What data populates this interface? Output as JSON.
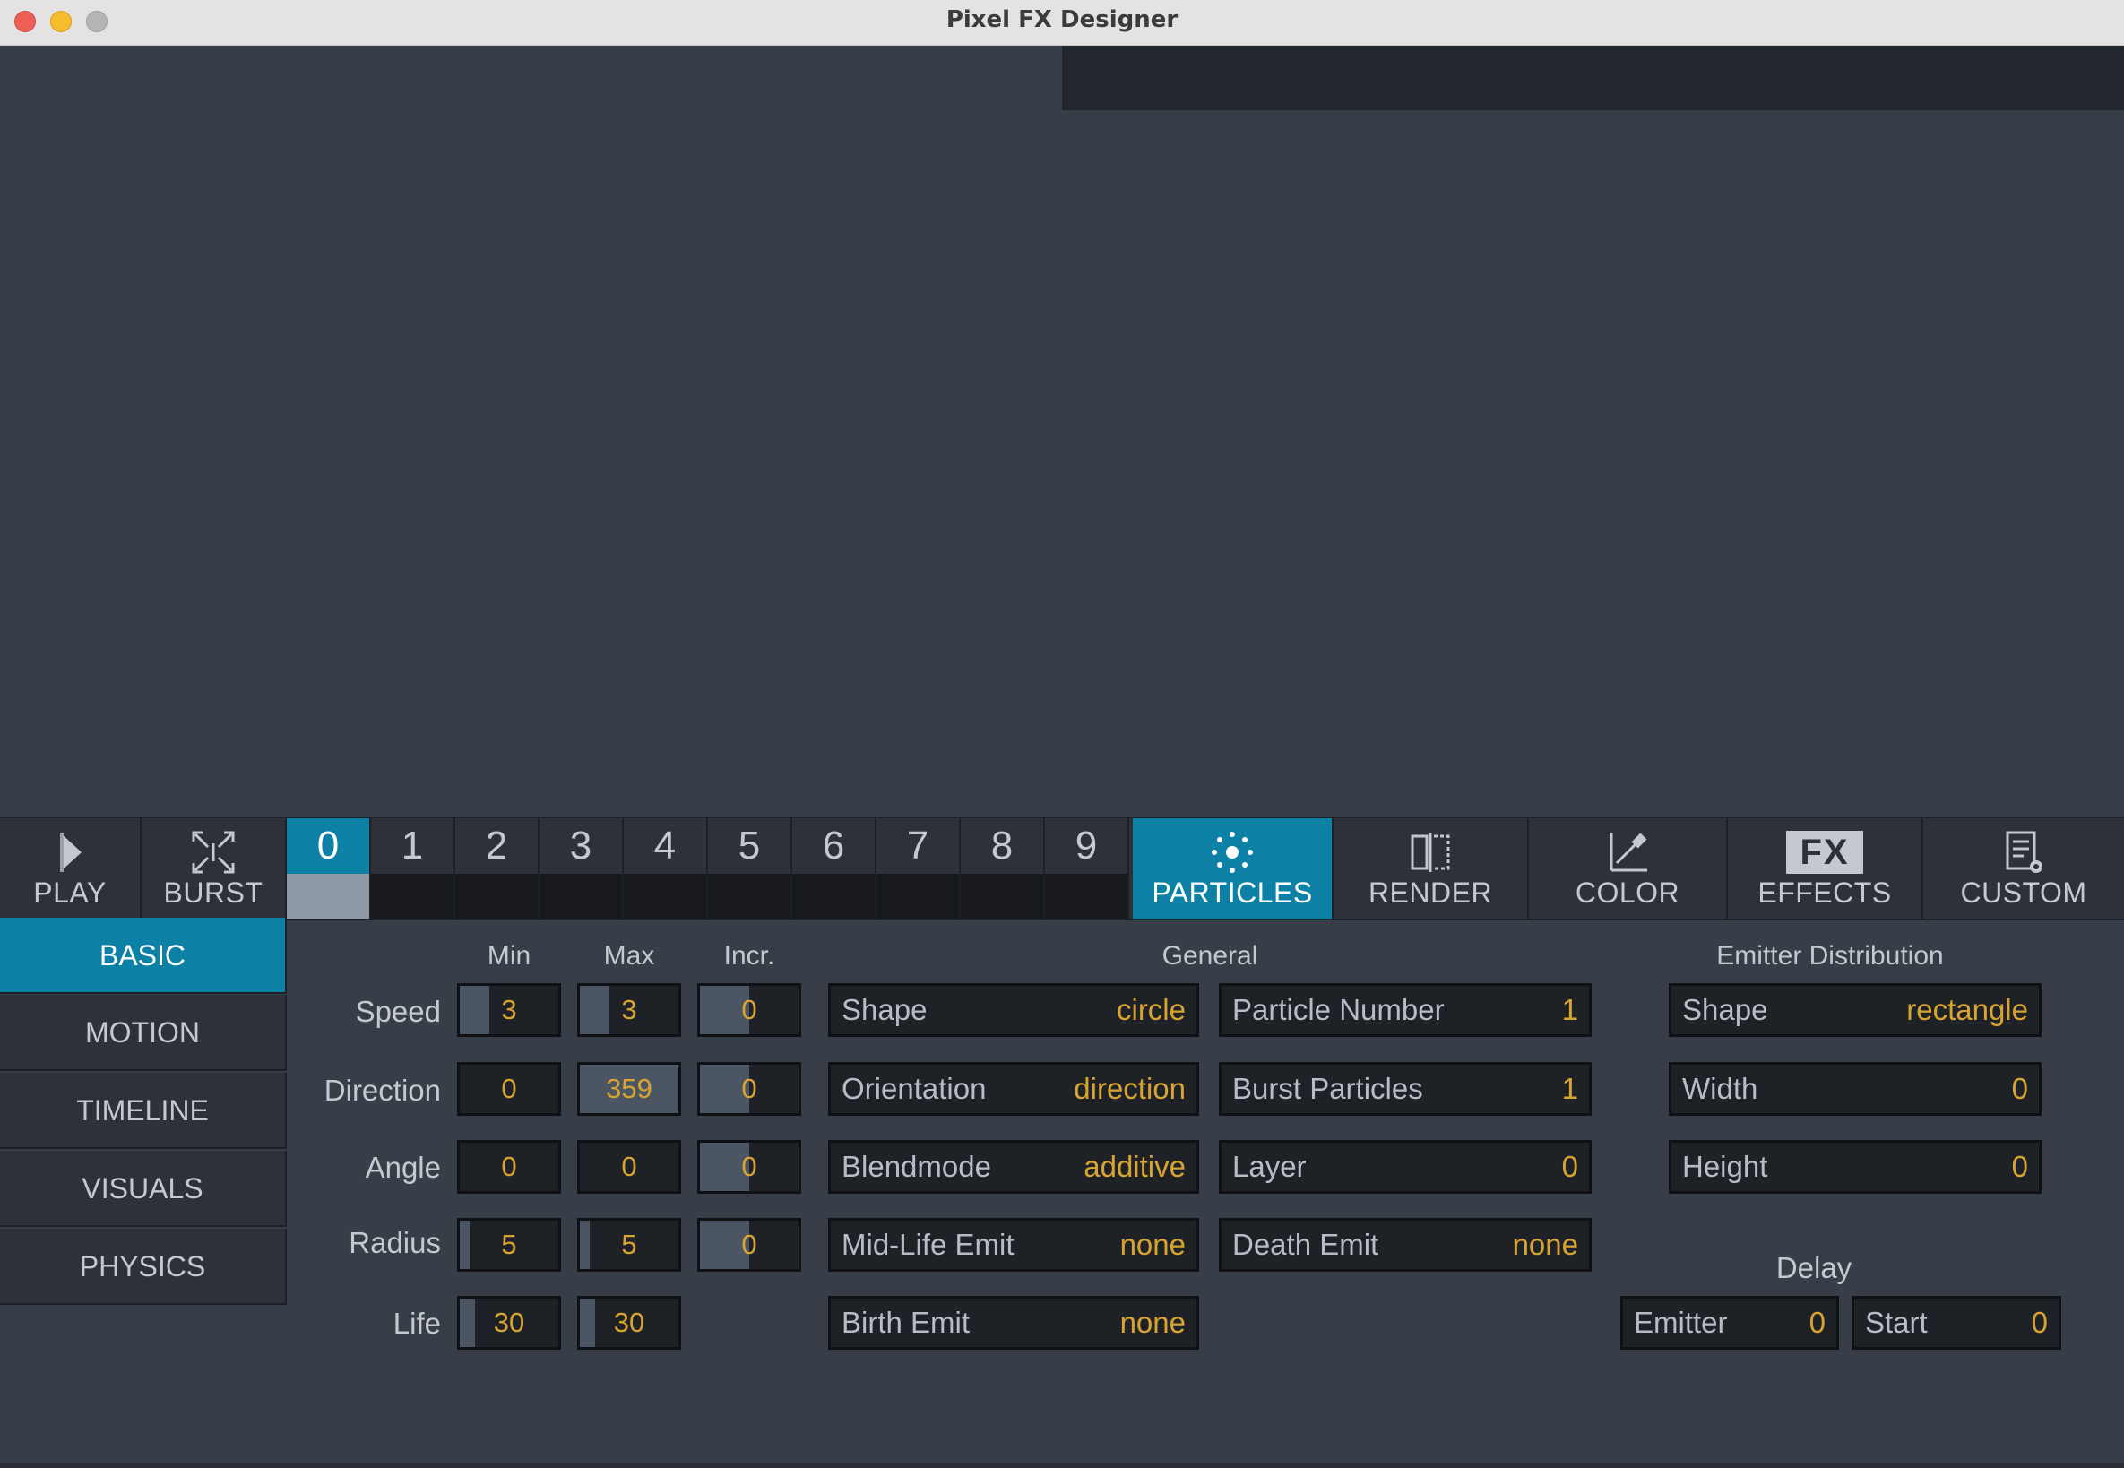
{
  "window": {
    "title": "Pixel FX Designer"
  },
  "toolbar": {
    "play": "PLAY",
    "burst": "BURST",
    "emitters": [
      "0",
      "1",
      "2",
      "3",
      "4",
      "5",
      "6",
      "7",
      "8",
      "9"
    ],
    "tabs": [
      {
        "label": "PARTICLES",
        "icon": "particles-icon"
      },
      {
        "label": "RENDER",
        "icon": "render-icon"
      },
      {
        "label": "COLOR",
        "icon": "color-picker-icon"
      },
      {
        "label": "EFFECTS",
        "icon": "fx-icon",
        "icon_text": "FX"
      },
      {
        "label": "CUSTOM",
        "icon": "custom-icon"
      }
    ]
  },
  "sidebar": {
    "items": [
      "BASIC",
      "MOTION",
      "TIMELINE",
      "VISUALS",
      "PHYSICS"
    ]
  },
  "columns": {
    "min": "Min",
    "max": "Max",
    "incr": "Incr."
  },
  "rows": [
    {
      "label": "Speed",
      "min": "3",
      "max": "3",
      "incr": "0",
      "min_fill": 0.3,
      "max_fill": 0.3,
      "incr_fill": 0.5
    },
    {
      "label": "Direction",
      "min": "0",
      "max": "359",
      "incr": "0",
      "min_fill": 0,
      "max_fill": 1,
      "incr_fill": 0.5
    },
    {
      "label": "Angle",
      "min": "0",
      "max": "0",
      "incr": "0",
      "min_fill": 0,
      "max_fill": 0,
      "incr_fill": 0.5
    },
    {
      "label": "Radius",
      "min": "5",
      "max": "5",
      "incr": "0",
      "min_fill": 0.1,
      "max_fill": 0.1,
      "incr_fill": 0.5
    },
    {
      "label": "Life",
      "min": "30",
      "max": "30",
      "min_fill": 0.15,
      "max_fill": 0.15
    }
  ],
  "general": {
    "heading": "General",
    "left": [
      {
        "key": "Shape",
        "value": "circle"
      },
      {
        "key": "Orientation",
        "value": "direction"
      },
      {
        "key": "Blendmode",
        "value": "additive"
      },
      {
        "key": "Mid-Life Emit",
        "value": "none"
      },
      {
        "key": "Birth Emit",
        "value": "none"
      }
    ],
    "right": [
      {
        "key": "Particle Number",
        "value": "1"
      },
      {
        "key": "Burst Particles",
        "value": "1"
      },
      {
        "key": "Layer",
        "value": "0"
      },
      {
        "key": "Death Emit",
        "value": "none"
      }
    ]
  },
  "emitter_distribution": {
    "heading": "Emitter Distribution",
    "fields": [
      {
        "key": "Shape",
        "value": "rectangle"
      },
      {
        "key": "Width",
        "value": "0"
      },
      {
        "key": "Height",
        "value": "0"
      }
    ]
  },
  "delay": {
    "heading": "Delay",
    "emitter": {
      "key": "Emitter",
      "value": "0"
    },
    "start": {
      "key": "Start",
      "value": "0"
    }
  },
  "colors": {
    "accent": "#0d80a6",
    "value": "#d8a431",
    "background": "#383e47"
  }
}
